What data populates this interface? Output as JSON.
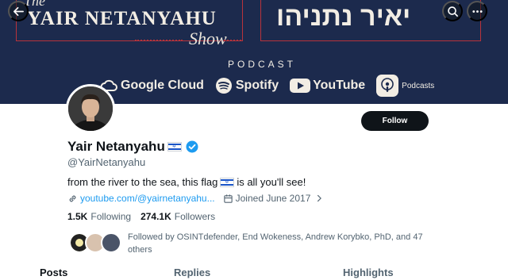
{
  "banner": {
    "the": "The",
    "title_en": "YAIR NETANYAHU",
    "show": "Show",
    "title_he": "יאיר נתניהו",
    "podcast_label": "PODCAST",
    "platforms": [
      "Google Cloud",
      "Spotify",
      "YouTube",
      "Podcasts"
    ]
  },
  "top_buttons": [
    "back-icon",
    "search-icon",
    "more-icon"
  ],
  "profile": {
    "display_name": "Yair Netanyahu",
    "handle": "@YairNetanyahu",
    "bio_before": "from the river to the sea, this flag",
    "bio_after": "is all you'll see!",
    "website": "youtube.com/@yairnetanyahu...",
    "joined": "Joined June 2017",
    "following_count": "1.5K",
    "following_label": "Following",
    "followers_count": "274.1K",
    "followers_label": "Followers",
    "followed_by": "Followed by OSINTdefender, End Wokeness, Andrew Korybko, PhD, and 47 others"
  },
  "follow_button": "Follow",
  "tabs": [
    "Posts",
    "Replies",
    "Highlights"
  ],
  "colors": {
    "accent": "#1d9bf0",
    "banner": "#1c2a4d",
    "banner_red": "#b8333b"
  }
}
